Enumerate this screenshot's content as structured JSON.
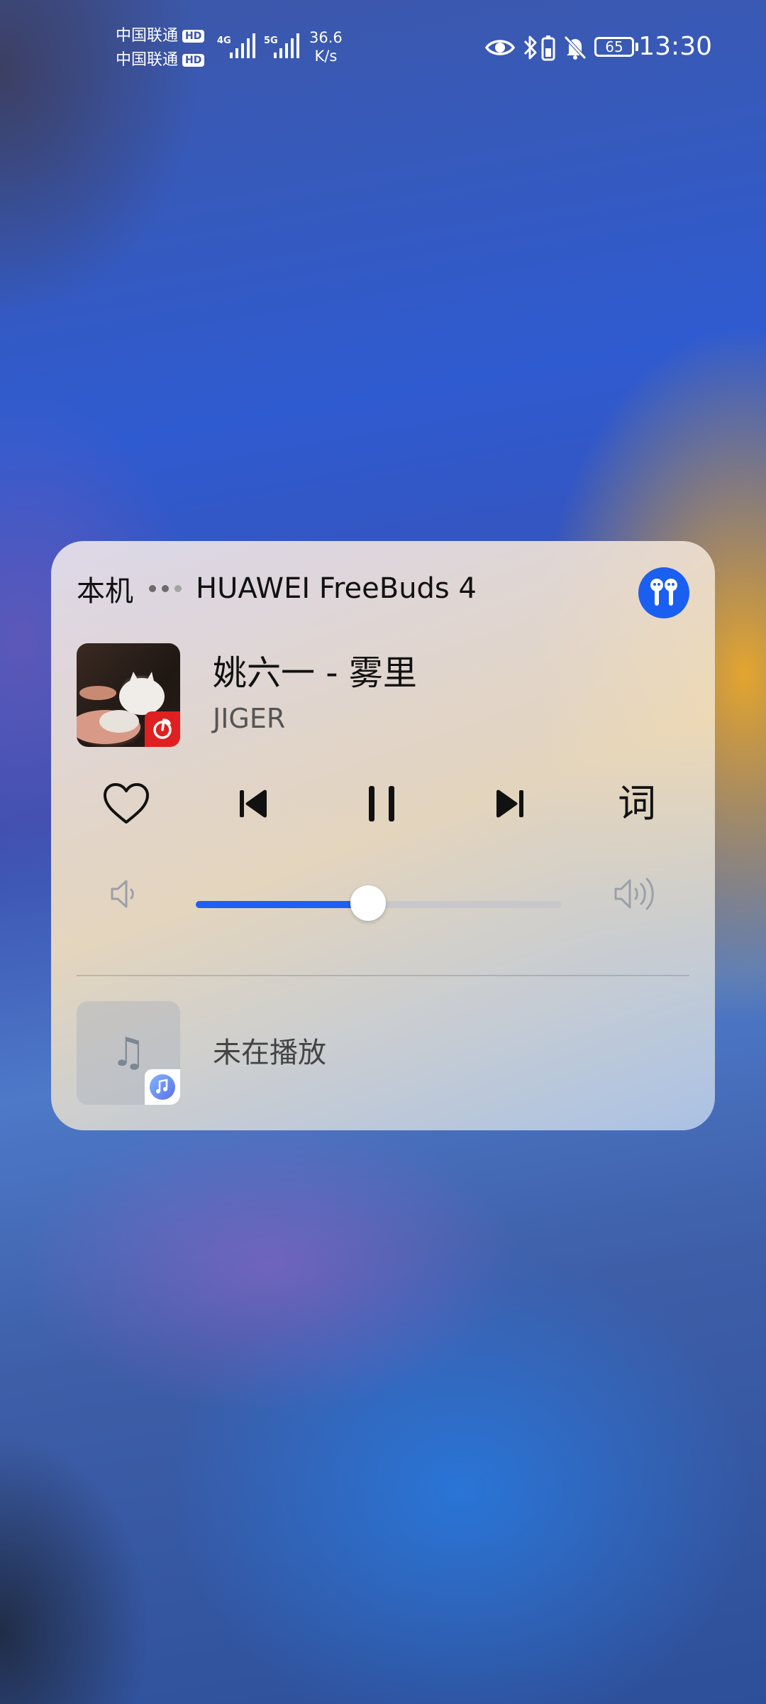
{
  "status_bar": {
    "carrier_1": "中国联通",
    "carrier_2": "中国联通",
    "hd_badge": "HD",
    "network_1": "4G",
    "network_2": "5G",
    "speed_value": "36.6",
    "speed_unit": "K/s",
    "battery_level": "65",
    "time": "13:30"
  },
  "media_card": {
    "device_local": "本机",
    "device_remote": "HUAWEI FreeBuds 4",
    "now_playing": {
      "title": "姚六一 - 雾里",
      "artist": "JIGER"
    },
    "lyrics_label": "词",
    "volume": {
      "level": 0.47
    },
    "accent_color": "#1e5ff5",
    "second_player": {
      "status": "未在播放"
    }
  }
}
